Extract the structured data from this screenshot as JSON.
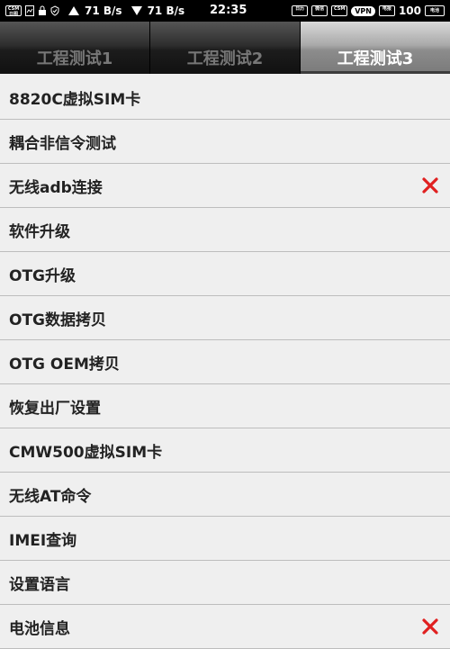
{
  "status_bar": {
    "left_icon_1_text": "CSM 日图",
    "speed_up": "71 B/s",
    "speed_down": "71 B/s",
    "time": "22:35",
    "right_icon_1_text": "日历",
    "right_icon_2_text": "微信",
    "right_icon_3_text": "CSM",
    "vpn": "VPN",
    "right_icon_4_text": "电报",
    "battery": "100",
    "right_icon_5_text": "电池"
  },
  "tabs": [
    {
      "label": "工程测试1",
      "active": false
    },
    {
      "label": "工程测试2",
      "active": false
    },
    {
      "label": "工程测试3",
      "active": true
    }
  ],
  "list": [
    {
      "label": "8820C虚拟SIM卡",
      "icon": ""
    },
    {
      "label": "耦合非信令测试",
      "icon": ""
    },
    {
      "label": "无线adb连接",
      "icon": "close-icon"
    },
    {
      "label": "软件升级",
      "icon": ""
    },
    {
      "label": "OTG升级",
      "icon": ""
    },
    {
      "label": "OTG数据拷贝",
      "icon": ""
    },
    {
      "label": "OTG OEM拷贝",
      "icon": ""
    },
    {
      "label": "恢复出厂设置",
      "icon": ""
    },
    {
      "label": "CMW500虚拟SIM卡",
      "icon": ""
    },
    {
      "label": "无线AT命令",
      "icon": ""
    },
    {
      "label": "IMEI查询",
      "icon": ""
    },
    {
      "label": "设置语言",
      "icon": ""
    },
    {
      "label": "电池信息",
      "icon": "close-icon"
    }
  ],
  "colors": {
    "close_icon": "#e02020",
    "background": "#efefef",
    "tab_active_text": "#ffffff",
    "tab_inactive_text": "#777777"
  }
}
